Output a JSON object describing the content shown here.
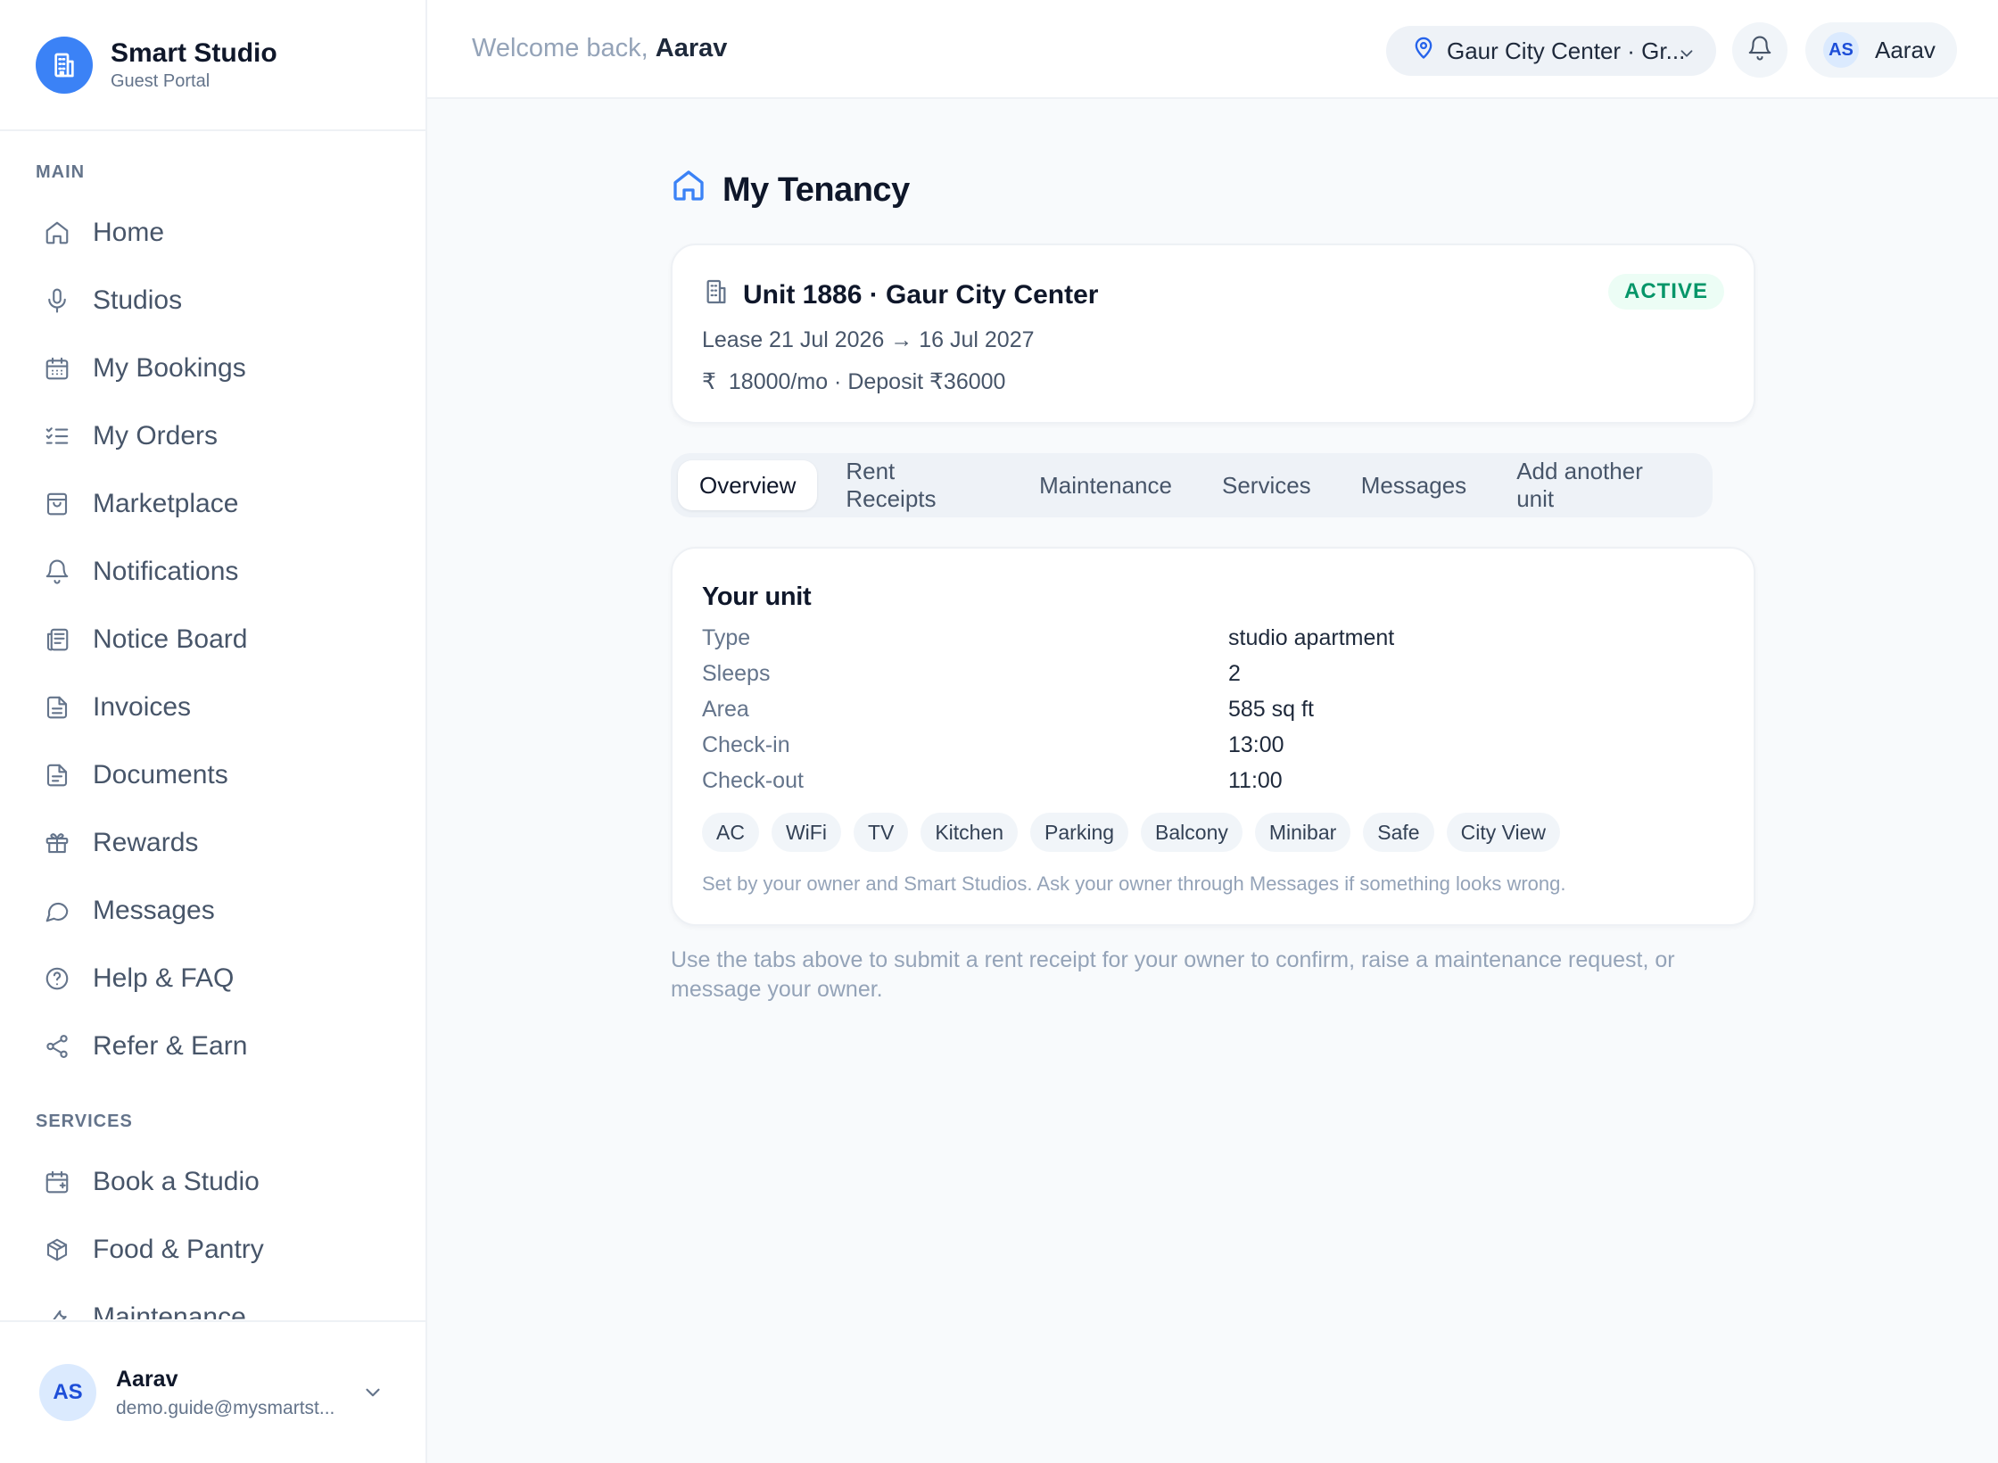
{
  "brand": {
    "title": "Smart Studio",
    "subtitle": "Guest Portal"
  },
  "sidebar": {
    "sections": [
      {
        "label": "MAIN",
        "items": [
          {
            "label": "Home",
            "icon": "home-icon"
          },
          {
            "label": "Studios",
            "icon": "mic-icon"
          },
          {
            "label": "My Bookings",
            "icon": "calendar-icon"
          },
          {
            "label": "My Orders",
            "icon": "list-check-icon"
          },
          {
            "label": "Marketplace",
            "icon": "shopping-bag-icon"
          },
          {
            "label": "Notifications",
            "icon": "bell-icon"
          },
          {
            "label": "Notice Board",
            "icon": "newspaper-icon"
          },
          {
            "label": "Invoices",
            "icon": "file-text-icon"
          },
          {
            "label": "Documents",
            "icon": "document-icon"
          },
          {
            "label": "Rewards",
            "icon": "gift-icon"
          },
          {
            "label": "Messages",
            "icon": "message-circle-icon"
          },
          {
            "label": "Help & FAQ",
            "icon": "help-circle-icon"
          },
          {
            "label": "Refer & Earn",
            "icon": "share-icon"
          }
        ]
      },
      {
        "label": "SERVICES",
        "items": [
          {
            "label": "Book a Studio",
            "icon": "calendar-plus-icon"
          },
          {
            "label": "Food & Pantry",
            "icon": "package-icon"
          },
          {
            "label": "Maintenance",
            "icon": "wrench-icon"
          }
        ]
      }
    ],
    "user": {
      "initials": "AS",
      "name": "Aarav",
      "email": "demo.guide@mysmartst..."
    }
  },
  "topbar": {
    "welcome_prefix": "Welcome back,",
    "welcome_name": "Aarav",
    "location": "Gaur City Center · Gr...",
    "user_initials": "AS",
    "user_name": "Aarav"
  },
  "page": {
    "title": "My Tenancy",
    "unit": {
      "title": "Unit 1886 · Gaur City Center",
      "status": "ACTIVE",
      "lease": "Lease 21 Jul 2026 → 16 Jul 2027",
      "rent": "18000/mo · Deposit ₹36000"
    },
    "tabs": [
      "Overview",
      "Rent Receipts",
      "Maintenance",
      "Services",
      "Messages",
      "Add another unit"
    ],
    "active_tab": "Overview",
    "your_unit": {
      "title": "Your unit",
      "rows": [
        {
          "key": "Type",
          "value": "studio apartment"
        },
        {
          "key": "Sleeps",
          "value": "2"
        },
        {
          "key": "Area",
          "value": "585 sq ft"
        },
        {
          "key": "Check-in",
          "value": "13:00"
        },
        {
          "key": "Check-out",
          "value": "11:00"
        }
      ],
      "amenities": [
        "AC",
        "WiFi",
        "TV",
        "Kitchen",
        "Parking",
        "Balcony",
        "Minibar",
        "Safe",
        "City View"
      ],
      "note": "Set by your owner and Smart Studios. Ask your owner through Messages if something looks wrong."
    },
    "help_text": "Use the tabs above to submit a rent receipt for your owner to confirm, raise a maintenance request, or message your owner."
  },
  "colors": {
    "accent": "#3b82f6",
    "active_badge": "#059669"
  }
}
